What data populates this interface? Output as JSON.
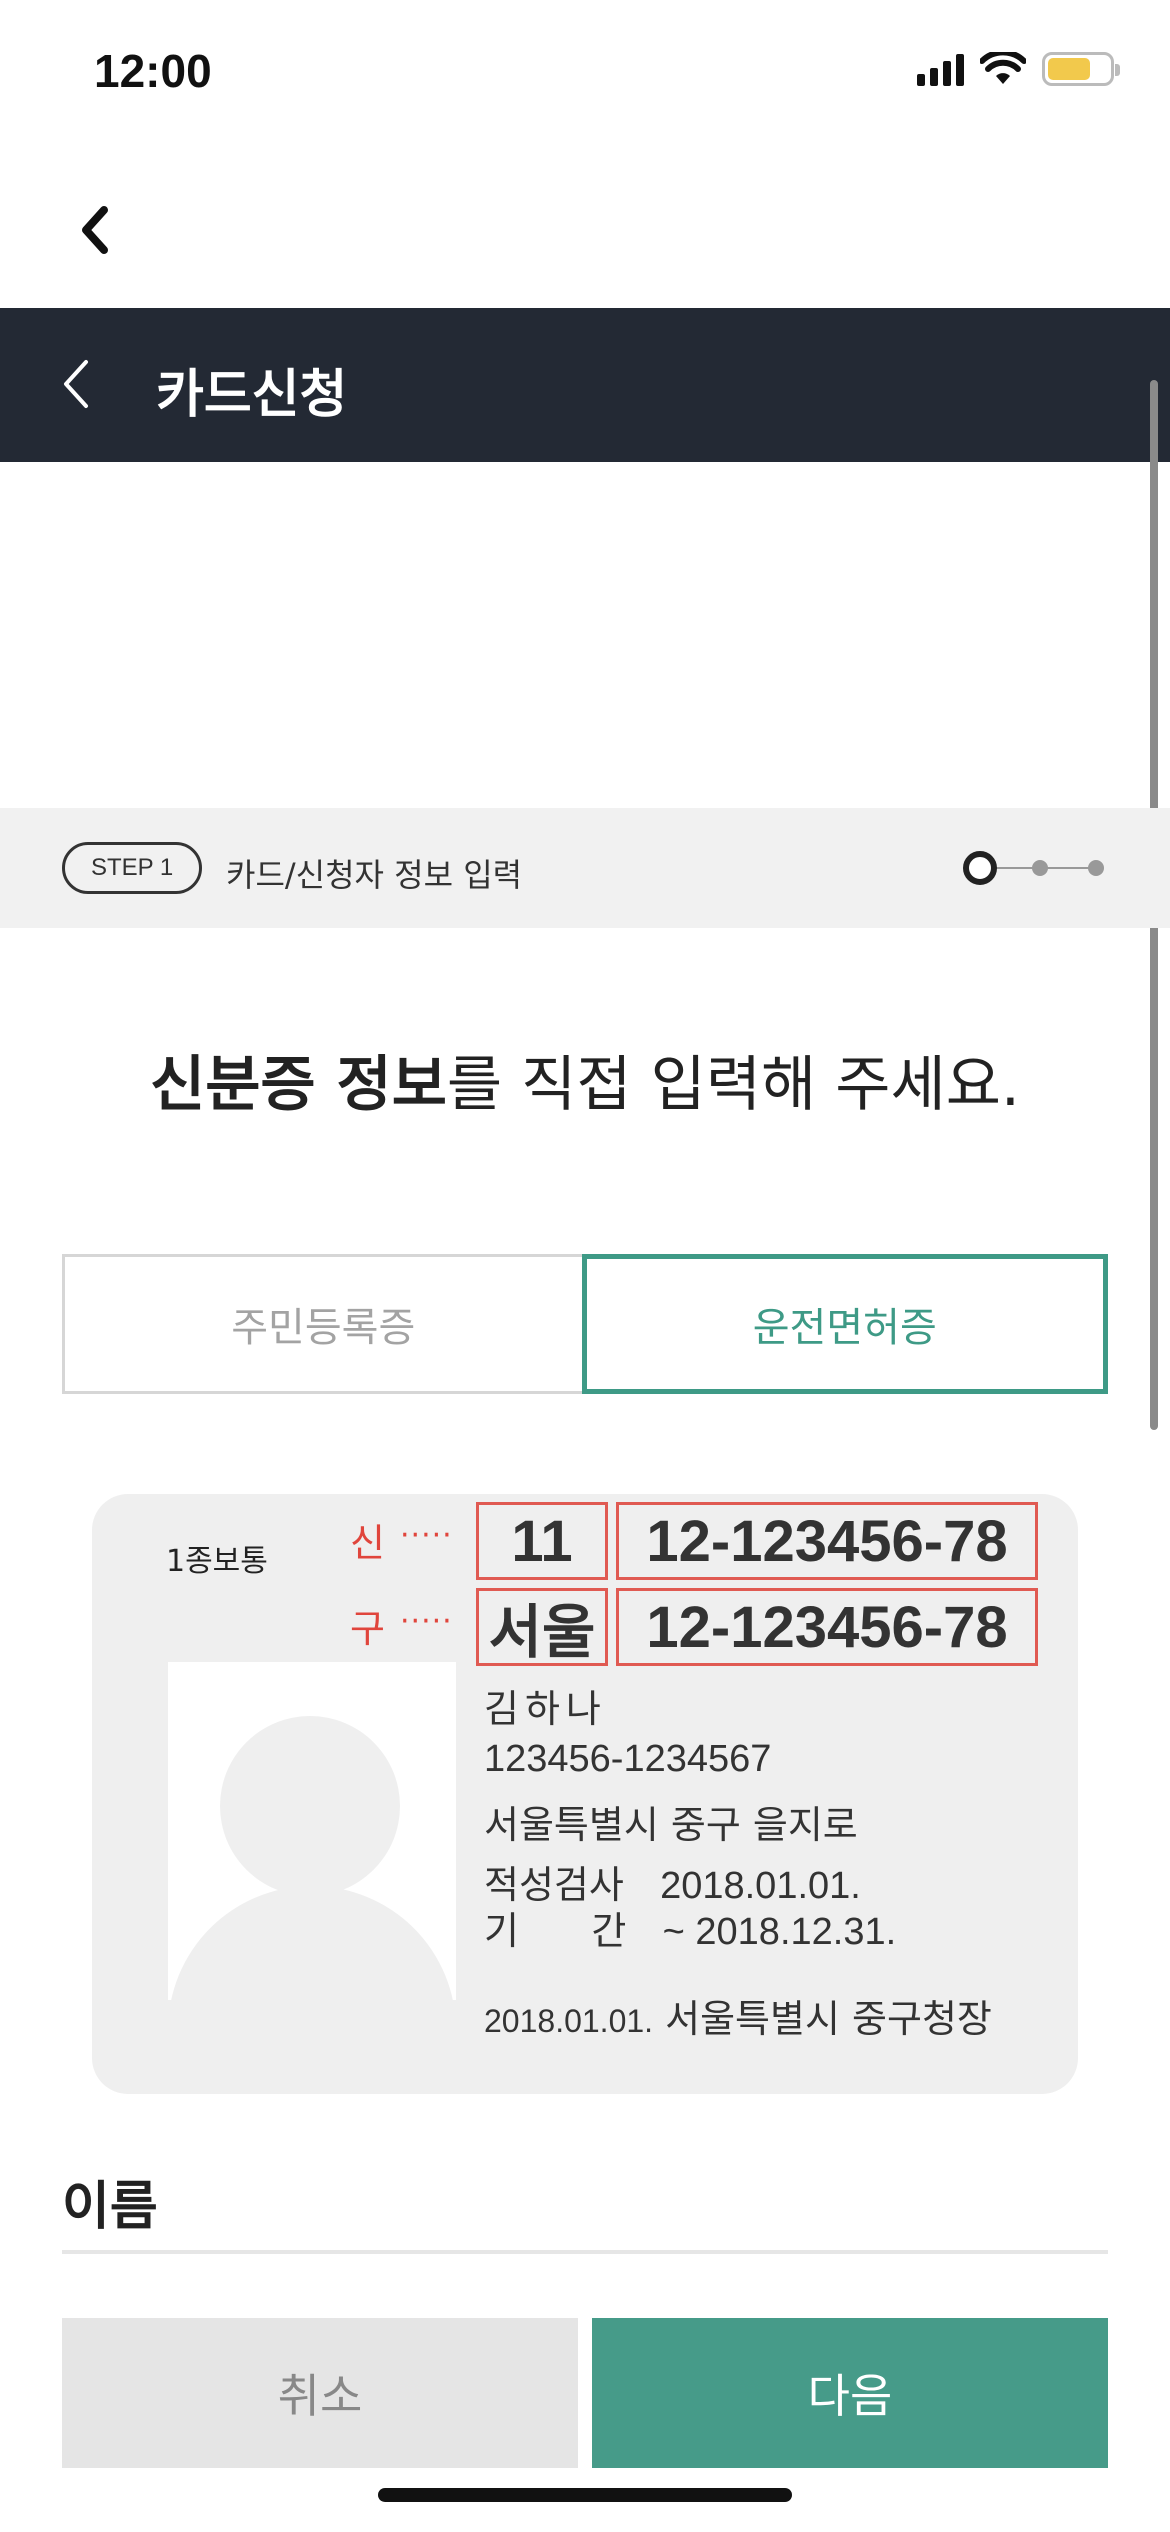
{
  "status_bar": {
    "time": "12:00",
    "icons": [
      "cellular-signal-icon",
      "wifi-icon",
      "battery-icon"
    ],
    "battery_color": "#f2c94c"
  },
  "top_nav": {
    "back_icon": "chevron-left-icon"
  },
  "header": {
    "title": "카드신청",
    "background": "#232934",
    "back_icon": "chevron-left-icon"
  },
  "step": {
    "badge": "STEP 1",
    "label": "카드/신청자 정보 입력",
    "current": 1,
    "total": 3
  },
  "headline": {
    "bold": "신분증 정보",
    "rest": "를 직접 입력해 주세요."
  },
  "tabs": [
    {
      "label": "주민등록증",
      "active": false
    },
    {
      "label": "운전면허증",
      "active": true
    }
  ],
  "license": {
    "type": "1종보통",
    "new_marker": "신",
    "old_marker": "구",
    "dots": "·····",
    "new_region": "11",
    "new_number": "12-123456-78",
    "old_region": "서울",
    "old_number": "12-123456-78",
    "name": "김하나",
    "rrn": "123456-1234567",
    "address": "서울특별시 중구 을지로",
    "test_label": "적성검사",
    "test_date": "2018.01.01.",
    "period_label": "기      간",
    "period_date": "~ 2018.12.31.",
    "issue_date": "2018.01.01.",
    "issuer": "서울특별시 중구청장"
  },
  "form": {
    "name_label": "이름"
  },
  "buttons": {
    "cancel": "취소",
    "next": "다음"
  },
  "colors": {
    "accent": "#469b89",
    "marker": "#e0453c"
  }
}
